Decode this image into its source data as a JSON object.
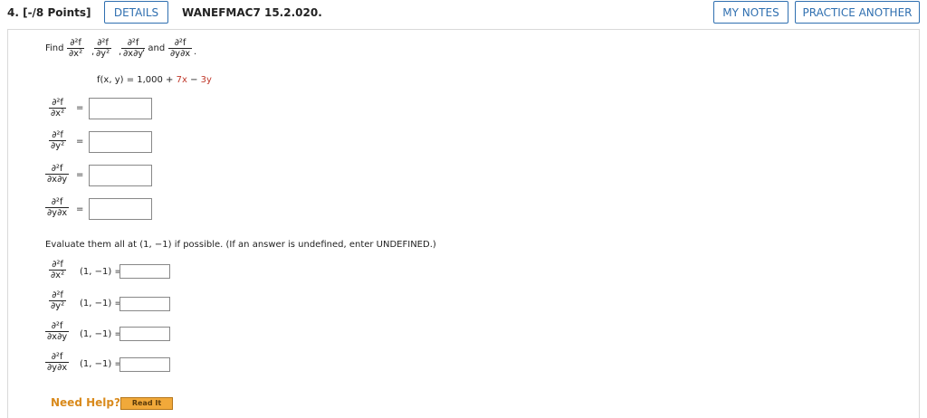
{
  "header": {
    "points": "4. [-/8 Points]",
    "details_label": "DETAILS",
    "assignment_code": "WANEFMAC7 15.2.020.",
    "my_notes_label": "MY NOTES",
    "practice_label": "PRACTICE ANOTHER"
  },
  "question": {
    "find_word": "Find",
    "and_word": ", and",
    "comma": ",",
    "period": ".",
    "function_lhs": "f(x, y) = 1,000 + ",
    "function_term1": "7x",
    "function_minus": " − ",
    "function_term2": "3y",
    "partials": {
      "num": "∂²f",
      "xx": "∂x²",
      "yy": "∂y²",
      "xy": "∂x∂y",
      "yx": "∂y∂x"
    },
    "equals": "=",
    "evaluate_text": "Evaluate them all at (1, −1) if possible. (If an answer is undefined, enter UNDEFINED.)",
    "point_eq": "(1, −1)  ="
  },
  "help": {
    "need_help": "Need Help?",
    "read_it": "Read It"
  }
}
